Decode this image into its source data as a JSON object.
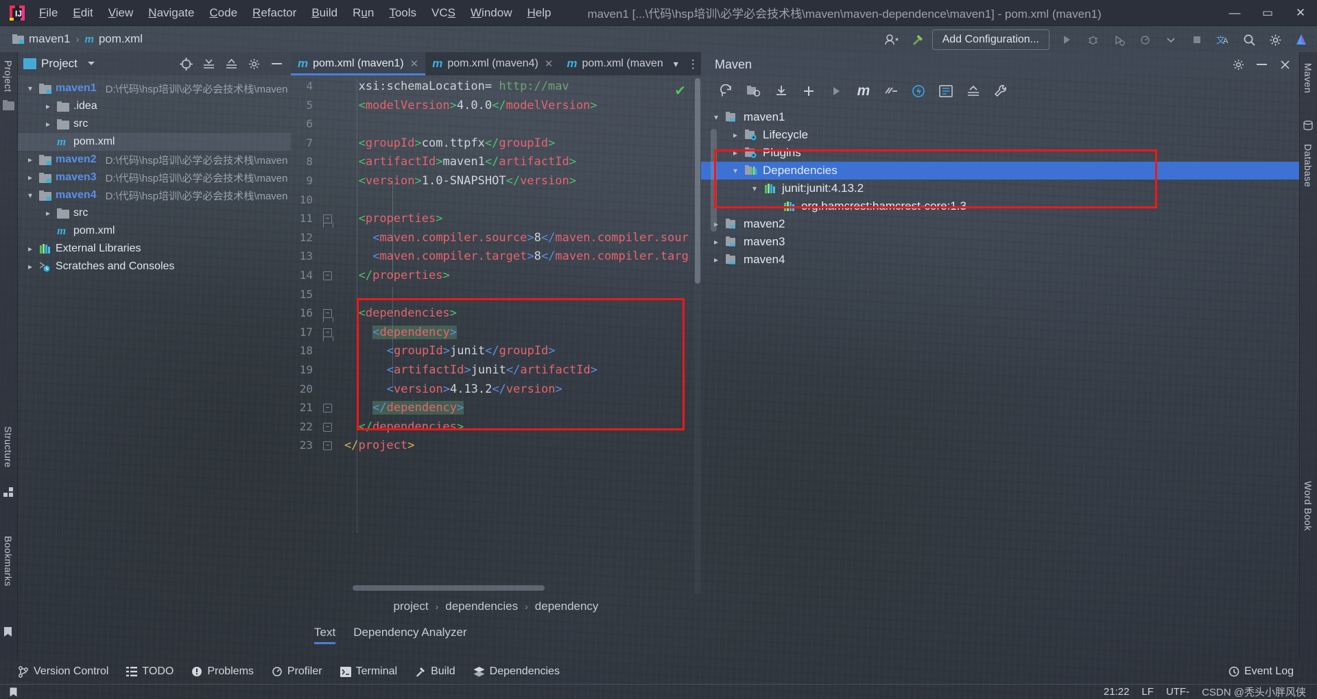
{
  "window": {
    "title": "maven1 [...\\代码\\hsp培训\\必学必会技术栈\\maven\\maven-dependence\\maven1] - pom.xml (maven1)",
    "minimize": "—",
    "maximize": "▭",
    "close": "✕"
  },
  "menu": [
    {
      "label": "File"
    },
    {
      "label": "Edit"
    },
    {
      "label": "View"
    },
    {
      "label": "Navigate"
    },
    {
      "label": "Code"
    },
    {
      "label": "Refactor"
    },
    {
      "label": "Build"
    },
    {
      "label": "Run"
    },
    {
      "label": "Tools"
    },
    {
      "label": "VCS"
    },
    {
      "label": "Window"
    },
    {
      "label": "Help"
    }
  ],
  "navbar": {
    "project": "maven1",
    "separator": "›",
    "file": "pom.xml"
  },
  "toolbar": {
    "add_configuration": "Add Configuration...",
    "icons": [
      "user-icon",
      "hammer-icon",
      "run-icon",
      "debug-icon",
      "run-coverage-icon",
      "profile-icon",
      "stop-icon",
      "translate-icon",
      "search-icon",
      "settings-icon",
      "ide-assistant-icon"
    ]
  },
  "left_strip": {
    "project": "Project",
    "structure": "Structure",
    "bookmarks": "Bookmarks"
  },
  "right_strip": {
    "maven": "Maven",
    "database": "Database",
    "word_book": "Word Book"
  },
  "project_panel": {
    "header": "Project",
    "tree": [
      {
        "depth": 0,
        "arrow": "v",
        "icon": "module-folder-icon",
        "label": "maven1",
        "bold": true,
        "path": "D:\\代码\\hsp培训\\必学必会技术栈\\maven"
      },
      {
        "depth": 1,
        "arrow": ">",
        "icon": "folder-icon",
        "label": ".idea",
        "bold": false,
        "path": ""
      },
      {
        "depth": 1,
        "arrow": ">",
        "icon": "folder-icon",
        "label": "src",
        "bold": false,
        "path": ""
      },
      {
        "depth": 1,
        "arrow": "",
        "icon": "maven-xml-icon",
        "label": "pom.xml",
        "bold": false,
        "path": "",
        "selected": true
      },
      {
        "depth": 0,
        "arrow": ">",
        "icon": "module-folder-icon",
        "label": "maven2",
        "bold": true,
        "path": "D:\\代码\\hsp培训\\必学必会技术栈\\maven"
      },
      {
        "depth": 0,
        "arrow": ">",
        "icon": "module-folder-icon",
        "label": "maven3",
        "bold": true,
        "path": "D:\\代码\\hsp培训\\必学必会技术栈\\maven"
      },
      {
        "depth": 0,
        "arrow": "v",
        "icon": "module-folder-icon",
        "label": "maven4",
        "bold": true,
        "path": "D:\\代码\\hsp培训\\必学必会技术栈\\maven"
      },
      {
        "depth": 1,
        "arrow": ">",
        "icon": "folder-icon",
        "label": "src",
        "bold": false,
        "path": ""
      },
      {
        "depth": 1,
        "arrow": "",
        "icon": "maven-xml-icon",
        "label": "pom.xml",
        "bold": false,
        "path": ""
      },
      {
        "depth": 0,
        "arrow": ">",
        "icon": "library-icon",
        "label": "External Libraries",
        "bold": false,
        "path": ""
      },
      {
        "depth": 0,
        "arrow": ">",
        "icon": "scratch-icon",
        "label": "Scratches and Consoles",
        "bold": false,
        "path": ""
      }
    ]
  },
  "editor": {
    "tabs": [
      {
        "label": "pom.xml (maven1)",
        "active": true,
        "closable": true
      },
      {
        "label": "pom.xml (maven4)",
        "active": false,
        "closable": true
      },
      {
        "label": "pom.xml (maven",
        "active": false,
        "closable": false
      }
    ],
    "tab_overflow_icon": "chevron-down-icon",
    "tab_options_icon": "more-vertical-icon",
    "inspection_status_icon": "check-icon",
    "lines": [
      {
        "num": "4",
        "indent": 2,
        "html": "<span class='v'>xsi:schemaLocation=</span> <span class='cmt'>http://mav</span>"
      },
      {
        "num": "5",
        "indent": 2,
        "html": "<span class='g'>&lt;</span><span class='r'>modelVersion</span><span class='g'>&gt;</span><span class='v'>4.0.0</span><span class='g'>&lt;/</span><span class='r'>modelVersion</span><span class='g'>&gt;</span>"
      },
      {
        "num": "6",
        "indent": 2,
        "html": ""
      },
      {
        "num": "7",
        "indent": 2,
        "html": "<span class='g'>&lt;</span><span class='r'>groupId</span><span class='g'>&gt;</span><span class='v'>com.ttpfx</span><span class='g'>&lt;/</span><span class='r'>groupId</span><span class='g'>&gt;</span>"
      },
      {
        "num": "8",
        "indent": 2,
        "html": "<span class='g'>&lt;</span><span class='r'>artifactId</span><span class='g'>&gt;</span><span class='v'>maven1</span><span class='g'>&lt;/</span><span class='r'>artifactId</span><span class='g'>&gt;</span>"
      },
      {
        "num": "9",
        "indent": 2,
        "html": "<span class='g'>&lt;</span><span class='r'>version</span><span class='g'>&gt;</span><span class='v'>1.0-SNAPSHOT</span><span class='g'>&lt;/</span><span class='r'>version</span><span class='g'>&gt;</span>"
      },
      {
        "num": "10",
        "indent": 2,
        "html": ""
      },
      {
        "num": "11",
        "indent": 2,
        "html": "<span class='g'>&lt;</span><span class='r'>properties</span><span class='g'>&gt;</span>"
      },
      {
        "num": "12",
        "indent": 4,
        "html": "<span class='b'>&lt;</span><span class='r'>maven.compiler.source</span><span class='b'>&gt;</span><span class='v'>8</span><span class='b'>&lt;/</span><span class='r'>maven.compiler.sour</span>"
      },
      {
        "num": "13",
        "indent": 4,
        "html": "<span class='b'>&lt;</span><span class='r'>maven.compiler.target</span><span class='b'>&gt;</span><span class='v'>8</span><span class='b'>&lt;/</span><span class='r'>maven.compiler.targ</span>"
      },
      {
        "num": "14",
        "indent": 2,
        "html": "<span class='g'>&lt;/</span><span class='r'>properties</span><span class='g'>&gt;</span>"
      },
      {
        "num": "15",
        "indent": 2,
        "html": ""
      },
      {
        "num": "16",
        "indent": 2,
        "html": "<span class='g'>&lt;</span><span class='r'>dependencies</span><span class='g'>&gt;</span>"
      },
      {
        "num": "17",
        "indent": 4,
        "html": "<span class='hl-tag'><span class='b'>&lt;</span><span class='r'>dependency</span><span class='b'>&gt;</span></span>"
      },
      {
        "num": "18",
        "indent": 6,
        "html": "<span class='b'>&lt;</span><span class='r'>groupId</span><span class='b'>&gt;</span><span class='v'>junit</span><span class='b'>&lt;/</span><span class='r'>groupId</span><span class='b'>&gt;</span>"
      },
      {
        "num": "19",
        "indent": 6,
        "html": "<span class='b'>&lt;</span><span class='r'>artifactId</span><span class='b'>&gt;</span><span class='v'>junit</span><span class='b'>&lt;/</span><span class='r'>artifactId</span><span class='b'>&gt;</span>"
      },
      {
        "num": "20",
        "indent": 6,
        "html": "<span class='b'>&lt;</span><span class='r'>version</span><span class='b'>&gt;</span><span class='v'>4.13.2</span><span class='b'>&lt;/</span><span class='r'>version</span><span class='b'>&gt;</span>"
      },
      {
        "num": "21",
        "indent": 4,
        "html": "<span class='hl-tag'><span class='b'>&lt;/</span><span class='r'>dependency</span><span class='b'>&gt;</span></span>"
      },
      {
        "num": "22",
        "indent": 2,
        "html": "<span class='g'>&lt;/</span><span class='r'>dependencies</span><span class='g'>&gt;</span>"
      },
      {
        "num": "23",
        "indent": 0,
        "html": "<span class='y'>&lt;/</span><span class='r'>project</span><span class='y'>&gt;</span>"
      }
    ],
    "breadcrumbs": [
      "project",
      "dependencies",
      "dependency"
    ],
    "breadcrumb_separator": "›",
    "bottom_tabs": [
      {
        "label": "Text",
        "active": true
      },
      {
        "label": "Dependency Analyzer",
        "active": false
      }
    ]
  },
  "maven_panel": {
    "title": "Maven",
    "settings_icon": "gear-icon",
    "minimize_icon": "minimize-icon",
    "hide_icon": "hide-icon",
    "toolbar_icons": [
      "reload-all-icon",
      "generate-sources-icon",
      "download-sources-icon",
      "add-icon",
      "run-icon",
      "maven-build-icon",
      "skip-tests-icon",
      "execute-goal-icon",
      "show-dependencies-icon",
      "collapse-all-icon",
      "settings-wrench-icon"
    ],
    "tree": [
      {
        "depth": 0,
        "arrow": "v",
        "icon": "maven-module-icon",
        "label": "maven1"
      },
      {
        "depth": 1,
        "arrow": ">",
        "icon": "lifecycle-folder-icon",
        "label": "Lifecycle"
      },
      {
        "depth": 1,
        "arrow": ">",
        "icon": "plugins-folder-icon",
        "label": "Plugins"
      },
      {
        "depth": 1,
        "arrow": "v",
        "icon": "dependencies-folder-icon",
        "label": "Dependencies",
        "selected": true
      },
      {
        "depth": 2,
        "arrow": "v",
        "icon": "library-icon",
        "label": "junit:junit:4.13.2"
      },
      {
        "depth": 3,
        "arrow": "",
        "icon": "library-icon",
        "label": "org.hamcrest:hamcrest-core:1.3"
      },
      {
        "depth": 0,
        "arrow": ">",
        "icon": "maven-module-icon",
        "label": "maven2"
      },
      {
        "depth": 0,
        "arrow": ">",
        "icon": "maven-module-icon",
        "label": "maven3"
      },
      {
        "depth": 0,
        "arrow": ">",
        "icon": "maven-module-icon",
        "label": "maven4"
      }
    ]
  },
  "statusbar": {
    "tools": [
      {
        "label": "Version Control",
        "icon": "branch-icon"
      },
      {
        "label": "TODO",
        "icon": "list-icon"
      },
      {
        "label": "Problems",
        "icon": "warning-icon"
      },
      {
        "label": "Profiler",
        "icon": "profiler-icon"
      },
      {
        "label": "Terminal",
        "icon": "terminal-icon"
      },
      {
        "label": "Build",
        "icon": "hammer-icon"
      },
      {
        "label": "Dependencies",
        "icon": "layers-icon"
      }
    ],
    "event_log": "Event Log",
    "time": "21:22",
    "line_separator": "LF",
    "encoding": "UTF-",
    "watermark": "CSDN @秃头小胖风侠"
  },
  "colors": {
    "accent_blue": "#4a7fe0",
    "selection_blue": "#3b72d4",
    "highlight_red": "#f01818",
    "tag_red": "#e8646b",
    "bracket_green": "#4ec26a",
    "bracket_blue": "#5b8fe8",
    "bracket_yellow": "#d8b14a",
    "maven_cyan": "#3cb0e0"
  }
}
